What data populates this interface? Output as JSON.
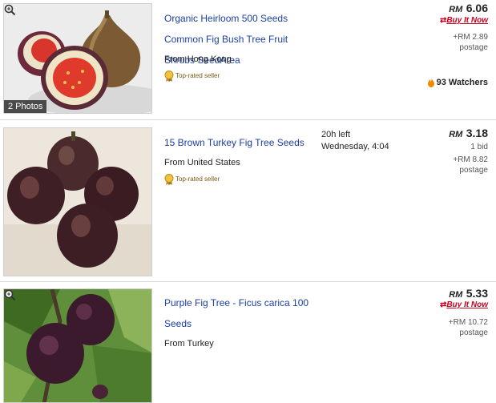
{
  "listings": [
    {
      "title": "Organic Heirloom 500 Seeds Common Fig Bush Tree Fruit Shrubs SeedArea",
      "from": "From Hong Kong",
      "top_rated": "Top-rated seller",
      "photos": "2 Photos",
      "currency": "RM",
      "price": "6.06",
      "buy_it_now": "Buy It Now",
      "postage": "+RM 2.89",
      "postage_label": "postage",
      "watchers": "93 Watchers"
    },
    {
      "title": "15 Brown Turkey Fig Tree Seeds",
      "from": "From United States",
      "top_rated": "Top-rated seller",
      "time_left": "20h left",
      "end_time": "Wednesday, 4:04",
      "currency": "RM",
      "price": "3.18",
      "bids": "1 bid",
      "postage": "+RM 8.82",
      "postage_label": "postage"
    },
    {
      "title": "Purple Fig Tree - Ficus carica 100 Seeds",
      "from": "From Turkey",
      "currency": "RM",
      "price": "5.33",
      "buy_it_now": "Buy It Now",
      "postage": "+RM 10.72",
      "postage_label": "postage"
    }
  ],
  "icons": {
    "zoom": "magnifier-icon",
    "medal": "top-rated-medal-icon",
    "flame": "flame-icon"
  },
  "colors": {
    "link": "#1b3fa3",
    "buy_it_now": "#c8001e",
    "flame": "#f08a00"
  }
}
